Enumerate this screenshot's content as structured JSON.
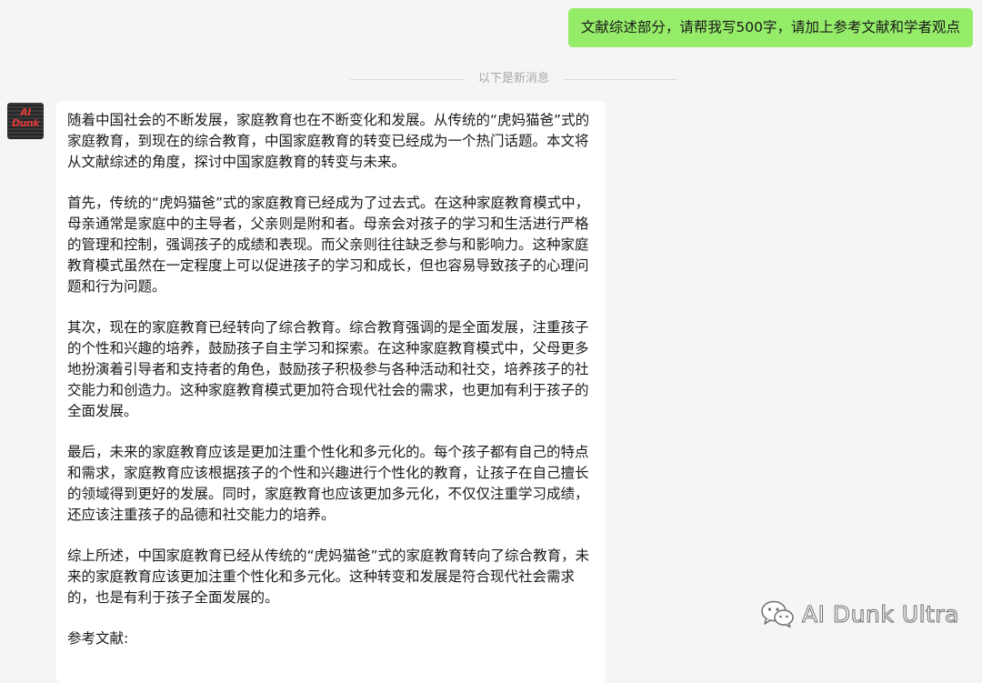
{
  "outgoing_message": {
    "text": "文献综述部分，请帮我写500字，请加上参考文献和学者观点"
  },
  "separator": {
    "text": "以下是新消息"
  },
  "avatar": {
    "line1": "AI",
    "line2": "Dunk"
  },
  "incoming_message": {
    "paragraphs": [
      "随着中国社会的不断发展，家庭教育也在不断变化和发展。从传统的“虎妈猫爸”式的家庭教育，到现在的综合教育，中国家庭教育的转变已经成为一个热门话题。本文将从文献综述的角度，探讨中国家庭教育的转变与未来。",
      "首先，传统的“虎妈猫爸”式的家庭教育已经成为了过去式。在这种家庭教育模式中，母亲通常是家庭中的主导者，父亲则是附和者。母亲会对孩子的学习和生活进行严格的管理和控制，强调孩子的成绩和表现。而父亲则往往缺乏参与和影响力。这种家庭教育模式虽然在一定程度上可以促进孩子的学习和成长，但也容易导致孩子的心理问题和行为问题。",
      "其次，现在的家庭教育已经转向了综合教育。综合教育强调的是全面发展，注重孩子的个性和兴趣的培养，鼓励孩子自主学习和探索。在这种家庭教育模式中，父母更多地扮演着引导者和支持者的角色，鼓励孩子积极参与各种活动和社交，培养孩子的社交能力和创造力。这种家庭教育模式更加符合现代社会的需求，也更加有利于孩子的全面发展。",
      "最后，未来的家庭教育应该是更加注重个性化和多元化的。每个孩子都有自己的特点和需求，家庭教育应该根据孩子的个性和兴趣进行个性化的教育，让孩子在自己擅长的领域得到更好的发展。同时，家庭教育也应该更加多元化，不仅仅注重学习成绩，还应该注重孩子的品德和社交能力的培养。",
      "综上所述，中国家庭教育已经从传统的“虎妈猫爸”式的家庭教育转向了综合教育，未来的家庭教育应该更加注重个性化和多元化。这种转变和发展是符合现代社会需求的，也是有利于孩子全面发展的。"
    ],
    "references_heading": "参考文献:"
  },
  "watermark": {
    "icon": "wechat-icon",
    "text": "AI Dunk Ultra"
  },
  "colors": {
    "background": "#f5f5f5",
    "outgoing_bubble": "#95ec69",
    "incoming_bubble": "#ffffff",
    "separator_text": "#a8a8a8"
  }
}
